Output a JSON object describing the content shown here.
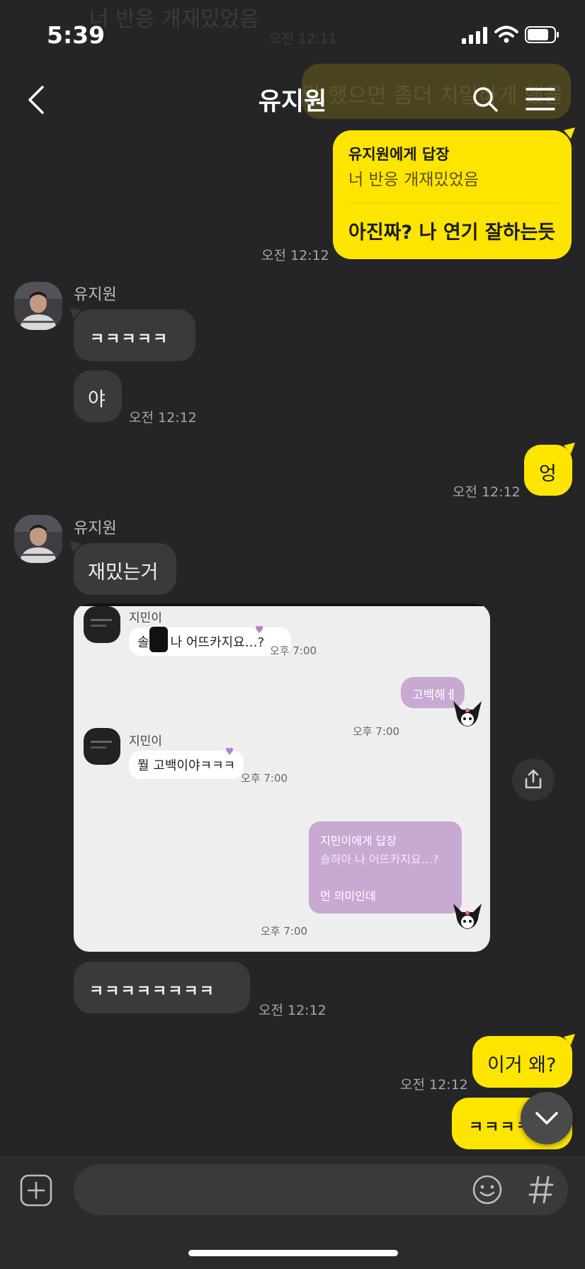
{
  "status_bar": {
    "time": "5:39"
  },
  "faded_top": {
    "message_1": "너 반응 개재밌었음",
    "time_1": "오전 12:11",
    "message_2": "말 했으면 좀더 치밀하게 했을"
  },
  "header": {
    "title": "유지원"
  },
  "messages": {
    "reply_card": {
      "reply_to": "유지원에게 답장",
      "quoted": "너 반응 개재밌었음",
      "text": "아진짜? 나 연기 잘하는듯",
      "time": "오전 12:12"
    },
    "group1": {
      "sender": "유지원",
      "msg1": "ㅋㅋㅋㅋㅋ",
      "msg2": "야",
      "time": "오전 12:12"
    },
    "mine_eung": {
      "text": "엉",
      "time": "오전 12:12"
    },
    "group2": {
      "sender": "유지원",
      "msg1": "재밌는거"
    },
    "screenshot": {
      "name1": "지민이",
      "msg1_prefix": "솔",
      "msg1_rest": "나 어뜨카지요…?",
      "time1": "오후 7:00",
      "mine1": "고백해ㅔ",
      "time2": "오후 7:00",
      "name2": "지민이",
      "msg2": "뭘 고백이야ㅋㅋㅋ",
      "time3": "오후 7:00",
      "reply_to": "지민이에게 답장",
      "reply_quote": "솔하아 나 어뜨카지요…?",
      "reply_text": "먼 의미인데",
      "time4": "오후 7:00"
    },
    "group2_last": {
      "text": "ㅋㅋㅋㅋㅋㅋㅋㅋ",
      "time": "오전 12:12"
    },
    "mine_why": {
      "text": "이거 왜?",
      "time": "오전 12:12"
    },
    "mine_last": {
      "text": "ㅋㅋㅋㅋ"
    }
  },
  "icons": {
    "back": "chevron-left-icon",
    "search": "search-icon",
    "menu": "menu-icon",
    "share": "share-icon",
    "scroll_down": "chevron-down-icon",
    "add": "plus-icon",
    "emoji": "emoji-icon",
    "hashtag": "hashtag-icon"
  },
  "colors": {
    "my_bubble": "#fee500",
    "their_bubble": "#3a3a3c",
    "background": "#252527"
  }
}
